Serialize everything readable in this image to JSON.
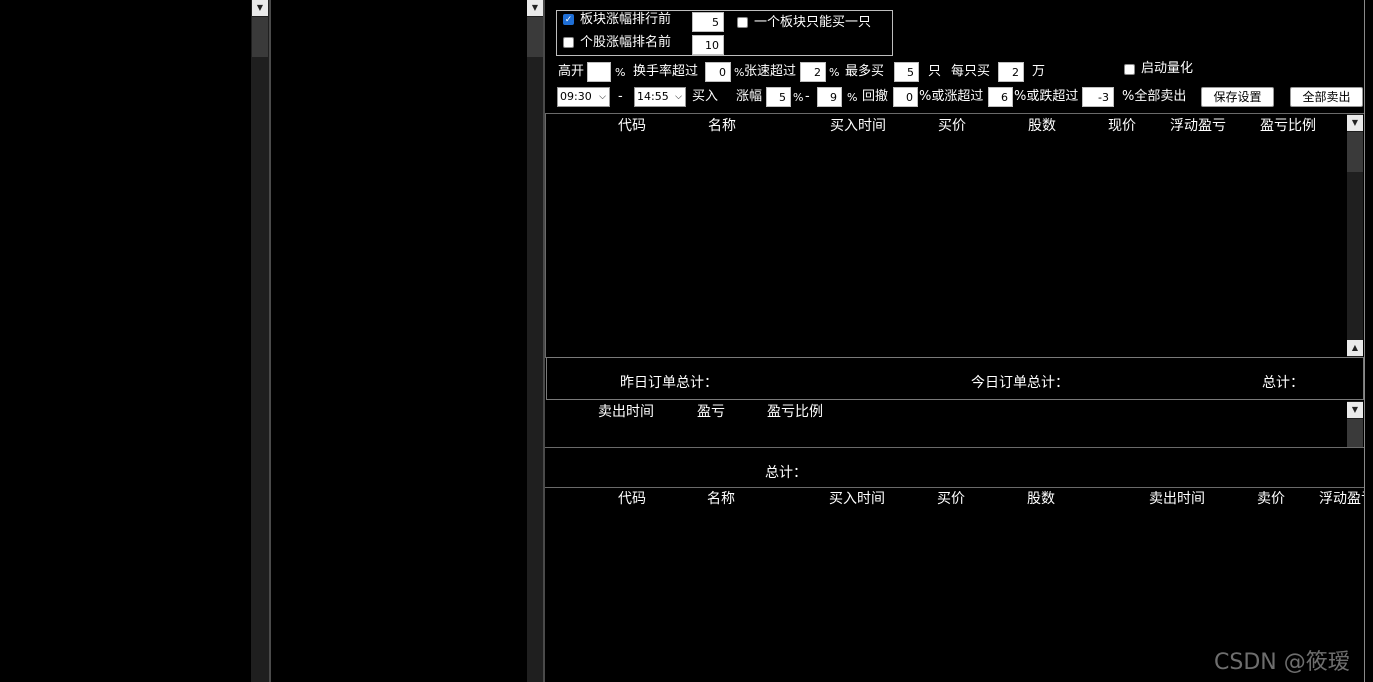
{
  "left_panel": {},
  "settings": {
    "sector_rank_label": "板块涨幅排行前",
    "sector_rank_value": "5",
    "sector_rank_checked": true,
    "stock_rank_label": "个股涨幅排名前",
    "stock_rank_value": "10",
    "stock_rank_checked": false,
    "one_per_sector_label": "一个板块只能买一只",
    "one_per_sector_checked": false,
    "gap_open_label": "高开",
    "gap_open_value": "",
    "pct": "%",
    "turnover_label": "换手率超过",
    "turnover_value": "0",
    "speed_label": "张速超过",
    "speed_value": "2",
    "max_buy_label": "最多买",
    "max_buy_value": "5",
    "max_buy_unit": "只",
    "per_buy_label": "每只买",
    "per_buy_value": "2",
    "per_buy_unit": "万",
    "enable_quant_label": "启动量化",
    "enable_quant_checked": false,
    "time_start": "09:30",
    "dash": "-",
    "time_end": "14:55",
    "buy_label": "买入",
    "rise_label": "涨幅",
    "rise_min": "5",
    "rise_max": "9",
    "pullback_label": "回撤",
    "pullback_value": "0",
    "or_rise_label": "%或涨超过",
    "or_rise_value": "6",
    "or_fall_label": "%或跌超过",
    "or_fall_value": "-3",
    "sell_all_pct_label": "%全部卖出",
    "save_button": "保存设置",
    "sell_all_button": "全部卖出"
  },
  "holdings_table": {
    "columns": [
      "代码",
      "名称",
      "买入时间",
      "买价",
      "股数",
      "现价",
      "浮动盈亏",
      "盈亏比例"
    ],
    "rows": []
  },
  "summary": {
    "yesterday_label": "昨日订单总计：",
    "today_label": "今日订单总计：",
    "total_label": "总计："
  },
  "sold_table": {
    "columns": [
      "卖出时间",
      "盈亏",
      "盈亏比例"
    ],
    "rows": [],
    "total_label": "总计："
  },
  "orders_table": {
    "columns": [
      "代码",
      "名称",
      "买入时间",
      "买价",
      "股数",
      "卖出时间",
      "卖价",
      "浮动盈亏"
    ],
    "rows": []
  },
  "watermark": "CSDN @筱瑷"
}
